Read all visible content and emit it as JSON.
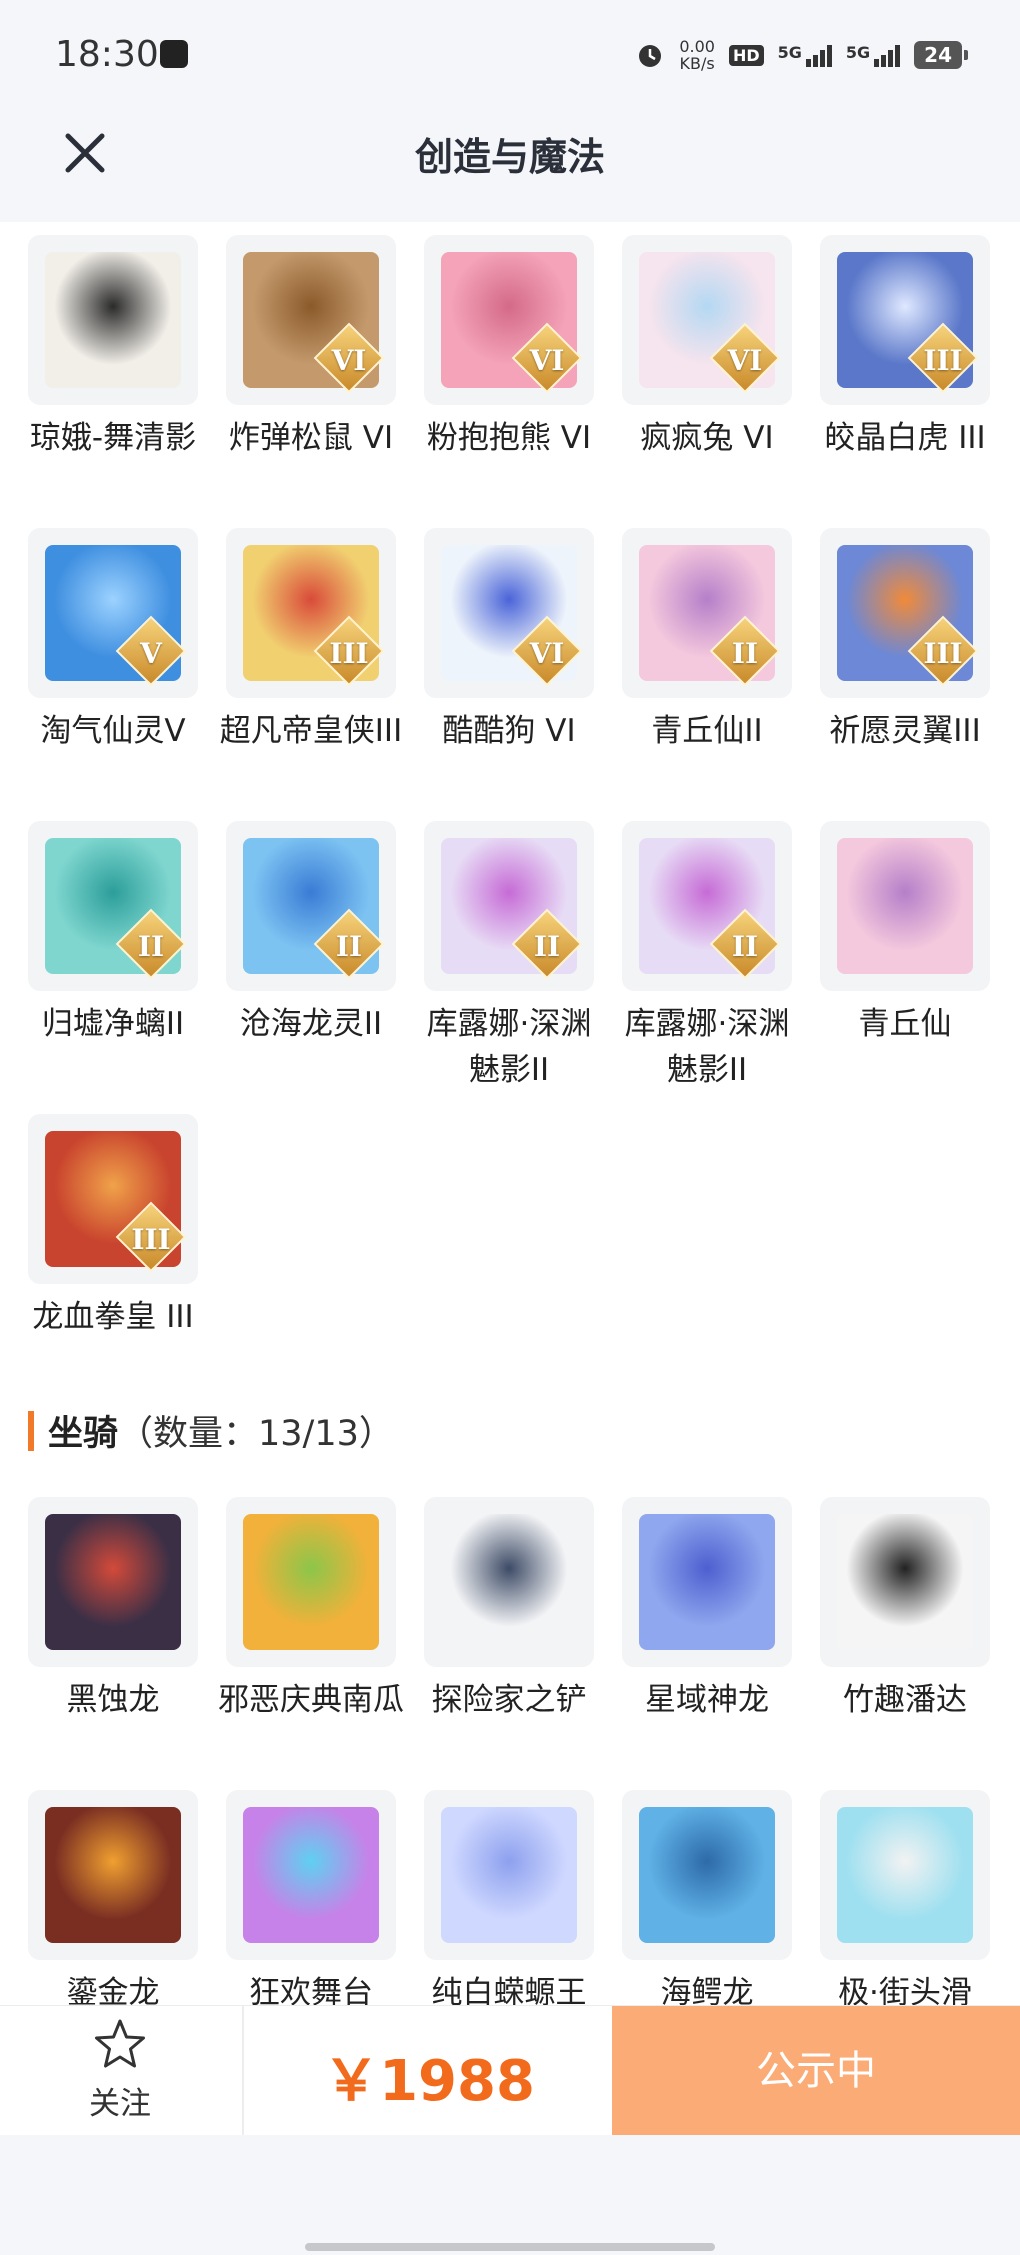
{
  "status_bar": {
    "time": "18:30",
    "net_speed_value": "0.00",
    "net_speed_unit": "KB/s",
    "hd_label": "HD",
    "sim1_label": "5G",
    "sim2_label": "5G",
    "battery": "24"
  },
  "header": {
    "title": "创造与魔法",
    "close_icon": "close-icon"
  },
  "top_items": [
    {
      "label": "琼娥-舞清影",
      "rank": "",
      "color": "#f2efe9",
      "accent": "#2b2b2b"
    },
    {
      "label": "炸弹松鼠 VI",
      "rank": "VI",
      "color": "#c49a6c",
      "accent": "#8b5a2b"
    },
    {
      "label": "粉抱抱熊 VI",
      "rank": "VI",
      "color": "#f4a3b8",
      "accent": "#d46a88"
    },
    {
      "label": "疯疯兔 VI",
      "rank": "VI",
      "color": "#f6e4ee",
      "accent": "#b4d8f2"
    },
    {
      "label": "皎晶白虎 III",
      "rank": "III",
      "color": "#5a77c9",
      "accent": "#dfe8ff"
    },
    {
      "label": "淘气仙灵V",
      "rank": "V",
      "color": "#3f8fe0",
      "accent": "#9cd2ff"
    },
    {
      "label": "超凡帝皇侠III",
      "rank": "III",
      "color": "#f1d070",
      "accent": "#d94b3a"
    },
    {
      "label": "酷酷狗 VI",
      "rank": "VI",
      "color": "#eef4fb",
      "accent": "#4a64d8"
    },
    {
      "label": "青丘仙II",
      "rank": "II",
      "color": "#f4c8dd",
      "accent": "#b67fc9"
    },
    {
      "label": "祈愿灵翼III",
      "rank": "III",
      "color": "#6c88d6",
      "accent": "#f08a3a"
    },
    {
      "label": "归墟净螭II",
      "rank": "II",
      "color": "#7fd6cf",
      "accent": "#2c9e9a"
    },
    {
      "label": "沧海龙灵II",
      "rank": "II",
      "color": "#7cc3f2",
      "accent": "#3a7bd5"
    },
    {
      "label": "库露娜·深渊魅影II",
      "rank": "II",
      "color": "#e7dcf5",
      "accent": "#c66bd6"
    },
    {
      "label": "库露娜·深渊魅影II",
      "rank": "II",
      "color": "#e7dcf5",
      "accent": "#c66bd6"
    },
    {
      "label": "青丘仙",
      "rank": "",
      "color": "#f4c8dd",
      "accent": "#b67fc9"
    },
    {
      "label": "龙血拳皇 III",
      "rank": "III",
      "color": "#c9442e",
      "accent": "#f0a24a"
    }
  ],
  "mounts_section": {
    "title": "坐骑",
    "count": "（数量：13/13）"
  },
  "mounts": [
    {
      "label": "黑蚀龙",
      "rank": "",
      "color": "#3b2f46",
      "accent": "#d34a3a"
    },
    {
      "label": "邪恶庆典南瓜",
      "rank": "",
      "color": "#f2b13a",
      "accent": "#8bc64a"
    },
    {
      "label": "探险家之铲",
      "rank": "",
      "color": "#f3f4f6",
      "accent": "#3d4b66"
    },
    {
      "label": "星域神龙",
      "rank": "",
      "color": "#8fa7ee",
      "accent": "#4d5fd0"
    },
    {
      "label": "竹趣潘达",
      "rank": "",
      "color": "#f5f5f5",
      "accent": "#222222"
    },
    {
      "label": "鎏金龙",
      "rank": "",
      "color": "#7a2e22",
      "accent": "#f0a030"
    },
    {
      "label": "狂欢舞台",
      "rank": "",
      "color": "#c682e8",
      "accent": "#5fd0f0"
    },
    {
      "label": "纯白蝾螈王",
      "rank": "",
      "color": "#cfd8ff",
      "accent": "#8da0ee"
    },
    {
      "label": "海鳄龙",
      "rank": "",
      "color": "#5fb1e6",
      "accent": "#2d6aa8"
    },
    {
      "label": "极·街头滑",
      "rank": "",
      "color": "#9fe0f0",
      "accent": "#f2f2f2"
    }
  ],
  "bottom_bar": {
    "follow_label": "关注",
    "price": "￥1988",
    "action_label": "公示中"
  }
}
